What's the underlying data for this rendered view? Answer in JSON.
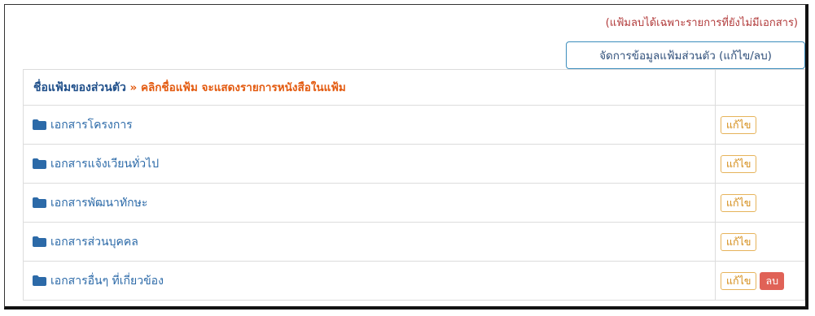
{
  "note": "(แฟ้มลบได้เฉพาะรายการที่ยังไม่มีเอกสาร)",
  "manage_button_label": "จัดการข้อมูลแฟ้มส่วนตัว (แก้ไข/ลบ)",
  "table": {
    "header_title": "ชื่อแฟ้มของส่วนตัว",
    "header_hint": " » คลิกชื่อแฟ้ม จะแสดงรายการหนังสือในแฟ้ม",
    "edit_label": "แก้ไข",
    "delete_label": "ลบ",
    "rows": [
      {
        "name": "เอกสารโครงการ"
      },
      {
        "name": "เอกสารแจ้งเวียนทั่วไป"
      },
      {
        "name": "เอกสารพัฒนาทักษะ"
      },
      {
        "name": "เอกสารส่วนบุคคล"
      },
      {
        "name": "เอกสารอื่นๆ ที่เกี่ยวข้อง"
      }
    ]
  },
  "colors": {
    "accent": "#3c8dbc",
    "warning": "#e6b35a",
    "danger": "#e06257",
    "hint": "#e35a0f"
  },
  "icons": {
    "folder": "folder-icon"
  }
}
